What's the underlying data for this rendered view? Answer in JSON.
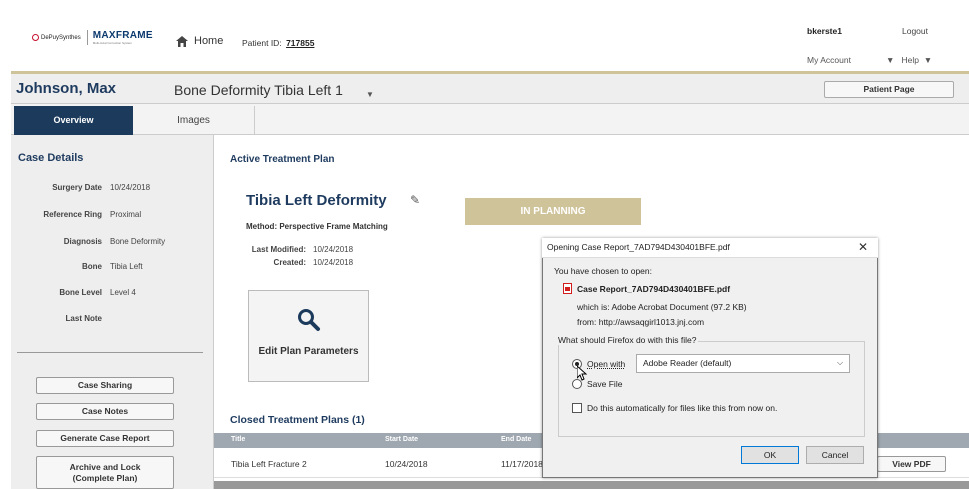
{
  "header": {
    "logo_depuy": "DePuySynthes",
    "logo_product": "MAXFRAME",
    "logo_product_sub": "Multi-Axial Correction System",
    "home_label": "Home",
    "patient_id_label": "Patient ID:",
    "patient_id_value": "717855",
    "username": "bkerste1",
    "logout_label": "Logout",
    "my_account_label": "My Account",
    "help_label": "Help",
    "caret": "▼"
  },
  "case_header": {
    "patient_name": "Johnson, Max",
    "case_name": "Bone Deformity Tibia Left 1",
    "patient_page_button": "Patient Page"
  },
  "tabs": [
    {
      "label": "Overview",
      "active": true
    },
    {
      "label": "Images",
      "active": false
    }
  ],
  "case_details": {
    "title": "Case Details",
    "fields": [
      {
        "label": "Surgery Date",
        "value": "10/24/2018"
      },
      {
        "label": "Reference Ring",
        "value": "Proximal"
      },
      {
        "label": "Diagnosis",
        "value": "Bone Deformity"
      },
      {
        "label": "Bone",
        "value": "Tibia Left"
      },
      {
        "label": "Bone Level",
        "value": "Level 4"
      },
      {
        "label": "Last Note",
        "value": ""
      }
    ],
    "buttons": [
      {
        "label": "Case Sharing"
      },
      {
        "label": "Case Notes"
      },
      {
        "label": "Generate Case Report"
      },
      {
        "label": "Archive and Lock (Complete Plan)"
      }
    ]
  },
  "active_plan": {
    "section_title": "Active Treatment Plan",
    "title": "Tibia Left Deformity",
    "status": "IN PLANNING",
    "method": "Method: Perspective Frame Matching",
    "last_modified_label": "Last Modified:",
    "last_modified_value": "10/24/2018",
    "created_label": "Created:",
    "created_value": "10/24/2018",
    "edit_button": "Edit Plan Parameters"
  },
  "closed_plans": {
    "section_title": "Closed Treatment Plans (1)",
    "columns": [
      "Title",
      "Start Date",
      "End Date"
    ],
    "rows": [
      {
        "title": "Tibia Left Fracture 2",
        "start": "10/24/2018",
        "end": "11/17/2018",
        "action": "View PDF"
      }
    ]
  },
  "dialog": {
    "title": "Opening Case Report_7AD794D430401BFE.pdf",
    "intro": "You have chosen to open:",
    "file_name": "Case Report_7AD794D430401BFE.pdf",
    "which_is": "which is: Adobe Acrobat Document (97.2 KB)",
    "from": "from: http://awsaqgirl1013.jnj.com",
    "question": "What should Firefox do with this file?",
    "open_with_label": "Open with",
    "open_with_value": "Adobe Reader  (default)",
    "save_file_label": "Save File",
    "auto_label": "Do this automatically for files like this from now on.",
    "ok_label": "OK",
    "cancel_label": "Cancel",
    "open_with_selected": true,
    "auto_checked": false
  },
  "colors": {
    "brand_navy": "#1b3a5c",
    "status_gold": "#cfc39a",
    "table_header": "#9fa7b0"
  }
}
